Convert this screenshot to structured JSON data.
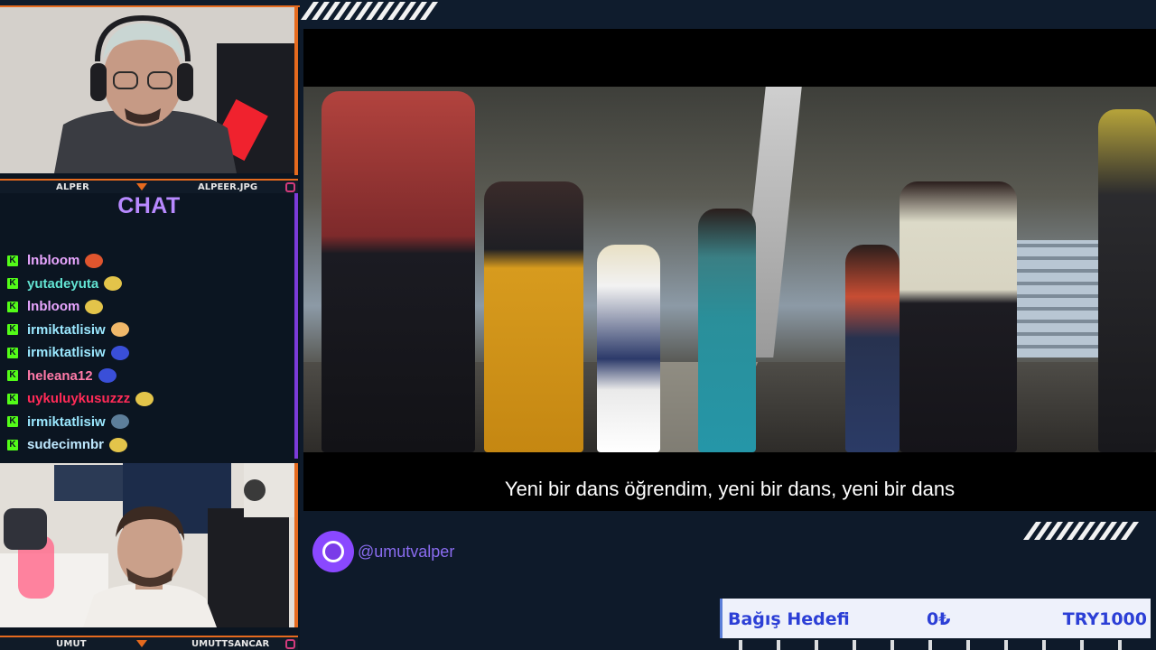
{
  "streamers": {
    "top": {
      "name": "ALPER",
      "handle": "ALPEER.JPG"
    },
    "bottom": {
      "name": "UMUT",
      "handle": "UMUTTSANCAR"
    }
  },
  "chat": {
    "title": "CHAT",
    "messages": [
      {
        "user": "lnbloom",
        "color": "#e9a6ff"
      },
      {
        "user": "yutadeyuta",
        "color": "#62e3d2"
      },
      {
        "user": "lnbloom",
        "color": "#e9a6ff"
      },
      {
        "user": "irmiktatlisiw",
        "color": "#9be8ff"
      },
      {
        "user": "irmiktatlisiw",
        "color": "#9be8ff"
      },
      {
        "user": "heleana12",
        "color": "#ff7aa8"
      },
      {
        "user": "uykuluykusuzzz",
        "color": "#ff2b57"
      },
      {
        "user": "irmiktatlisiw",
        "color": "#9be8ff"
      },
      {
        "user": "sudecimnbr",
        "color": "#bfe9ff"
      }
    ]
  },
  "video": {
    "subtitle": "Yeni bir dans öğrendim, yeni bir dans, yeni bir dans"
  },
  "social": {
    "handle": "@umutvalper"
  },
  "donation": {
    "label": "Bağış Hedefi",
    "current": "0₺",
    "goal": "TRY1000"
  },
  "colors": {
    "accent": "#e56a1e",
    "chat_title": "#b889ff",
    "kick_green": "#53fc18"
  }
}
